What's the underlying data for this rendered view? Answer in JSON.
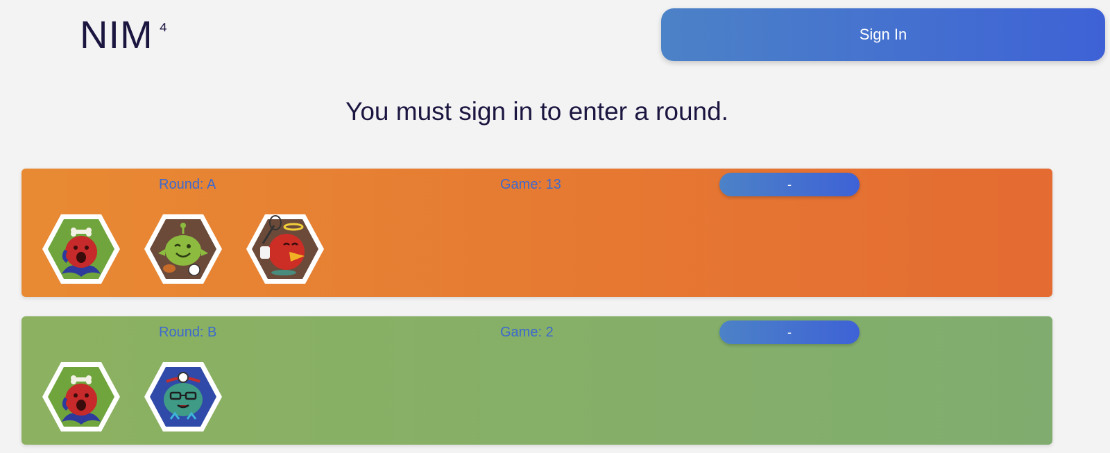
{
  "header": {
    "logo_text": "NIM",
    "logo_sup": "⁴",
    "signin_label": "Sign In"
  },
  "notice": "You must sign in to enter a round.",
  "rounds": [
    {
      "round_label": "Round: A",
      "game_label": "Game: 13",
      "button_label": "-",
      "color": "#e67a33",
      "players": [
        {
          "icon": "red-crying-monster-avatar",
          "bg": "#6fa53c"
        },
        {
          "icon": "green-winking-monster-avatar",
          "bg": "#6b4a3a"
        },
        {
          "icon": "red-bird-angel-avatar",
          "bg": "#6b4a3a"
        }
      ]
    },
    {
      "round_label": "Round: B",
      "game_label": "Game: 2",
      "button_label": "-",
      "color": "#87af67",
      "players": [
        {
          "icon": "red-crying-monster-avatar",
          "bg": "#6fa53c"
        },
        {
          "icon": "teal-doctor-monster-avatar",
          "bg": "#2f4aa8"
        }
      ]
    }
  ]
}
